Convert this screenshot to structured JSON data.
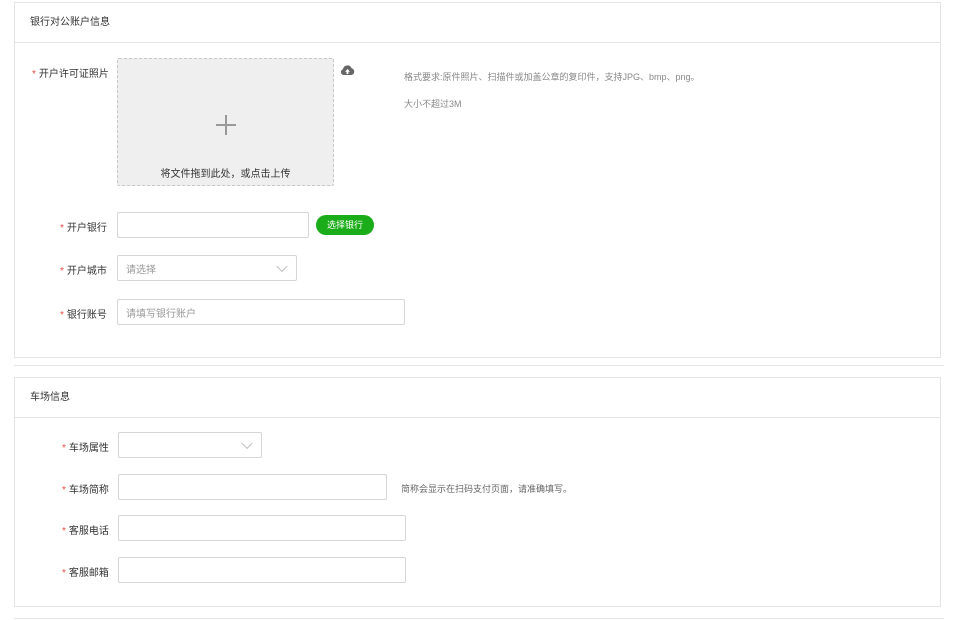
{
  "bank_section": {
    "title": "银行对公账户信息",
    "license_label": "开户许可证照片",
    "upload_text": "将文件拖到此处，或点击上传",
    "hint_format": "格式要求:原件照片、扫描件或加盖公章的复印件，支持JPG、bmp、png。",
    "hint_size": "大小不超过3M",
    "bank_label": "开户银行",
    "bank_value": "",
    "select_bank_button": "选择银行",
    "city_label": "开户城市",
    "city_placeholder": "请选择",
    "account_label": "银行账号",
    "account_placeholder": "请填写银行账户"
  },
  "parking_section": {
    "title": "车场信息",
    "attribute_label": "车场属性",
    "attribute_value": "",
    "short_name_label": "车场简称",
    "short_name_value": "",
    "short_name_hint": "简称会显示在扫码支付页面，请准确填写。",
    "phone_label": "客服电话",
    "phone_value": "",
    "email_label": "客服邮箱",
    "email_value": ""
  },
  "required_mark": "*",
  "colors": {
    "accent_green": "#1aad19",
    "required_red": "#e54d42"
  },
  "icons": {
    "upload": "cloud-upload-icon",
    "add": "plus-icon",
    "dropdown": "chevron-down-icon"
  }
}
